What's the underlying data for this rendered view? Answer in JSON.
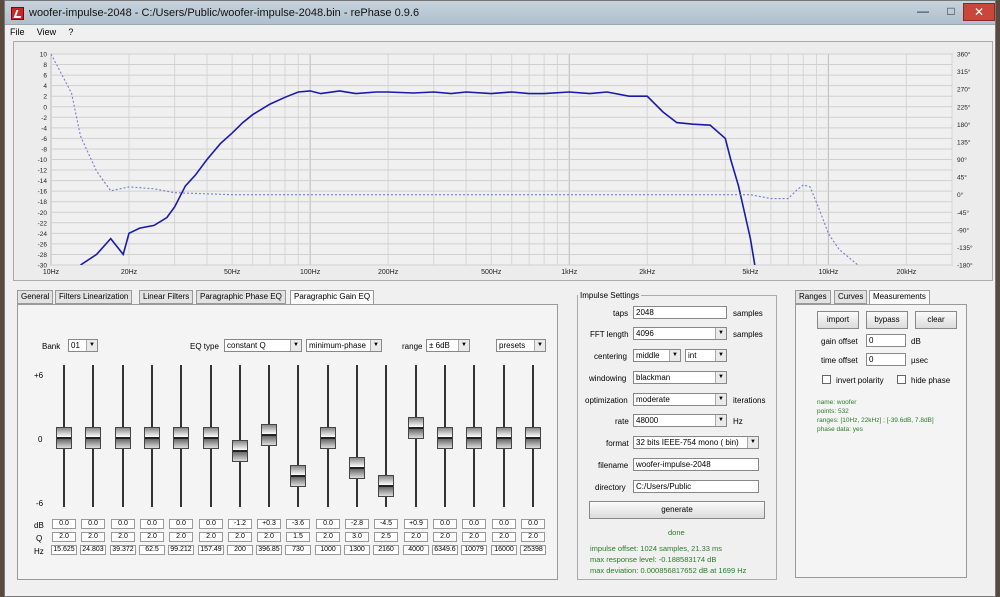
{
  "window": {
    "title": "woofer-impulse-2048  -  C:/Users/Public/woofer-impulse-2048.bin  -  rePhase 0.9.6"
  },
  "menu": [
    "File",
    "View",
    "?"
  ],
  "plot": {
    "y_left_ticks": [
      "10",
      "8",
      "6",
      "4",
      "2",
      "0",
      "-2",
      "-4",
      "-6",
      "-8",
      "-10",
      "-12",
      "-14",
      "-16",
      "-18",
      "-20",
      "-22",
      "-24",
      "-26",
      "-28",
      "-30"
    ],
    "y_right_ticks": [
      "360°",
      "315°",
      "270°",
      "225°",
      "180°",
      "135°",
      "90°",
      "45°",
      "0°",
      "-45°",
      "-90°",
      "-135°",
      "-180°"
    ],
    "x_ticks": [
      "10Hz",
      "20Hz",
      "50Hz",
      "100Hz",
      "200Hz",
      "500Hz",
      "1kHz",
      "2kHz",
      "5kHz",
      "10kHz",
      "20kHz"
    ]
  },
  "tabs": [
    "General",
    "Filters Linearization",
    "Linear Filters",
    "Paragraphic Phase EQ",
    "Paragraphic Gain EQ"
  ],
  "eq": {
    "bank_label": "Bank",
    "bank": "01",
    "eqtype_label": "EQ type",
    "eqtype": "constant Q",
    "phase": "minimum-phase",
    "range_label": "range",
    "range": "± 6dB",
    "presets": "presets",
    "scale": [
      "+6",
      "0",
      "-6"
    ],
    "row_labels": [
      "dB",
      "Q",
      "Hz"
    ],
    "db": [
      "0.0",
      "0.0",
      "0.0",
      "0.0",
      "0.0",
      "0.0",
      "-1.2",
      "+0.3",
      "-3.6",
      "0.0",
      "-2.8",
      "-4.5",
      "+0.9",
      "0.0",
      "0.0",
      "0.0",
      "0.0"
    ],
    "q": [
      "2.0",
      "2.0",
      "2.0",
      "2.0",
      "2.0",
      "2.0",
      "2.0",
      "2.0",
      "1.5",
      "2.0",
      "3.0",
      "2.5",
      "2.0",
      "2.0",
      "2.0",
      "2.0",
      "2.0"
    ],
    "hz": [
      "15.625",
      "24.803",
      "39.372",
      "62.5",
      "99.212",
      "157.49",
      "200",
      "396.85",
      "730",
      "1000",
      "1300",
      "2160",
      "4000",
      "6349.6",
      "10079",
      "16000",
      "25398"
    ]
  },
  "impulse": {
    "legend": "Impulse Settings",
    "taps_label": "taps",
    "taps": "2048",
    "taps_unit": "samples",
    "fft_label": "FFT length",
    "fft": "4096",
    "fft_unit": "samples",
    "centering_label": "centering",
    "centering": "middle",
    "centering2": "int",
    "windowing_label": "windowing",
    "windowing": "blackman",
    "optimization_label": "optimization",
    "optimization": "moderate",
    "optimization_unit": "iterations",
    "rate_label": "rate",
    "rate": "48000",
    "rate_unit": "Hz",
    "format_label": "format",
    "format": "32 bits IEEE-754 mono ( bin)",
    "filename_label": "filename",
    "filename": "woofer-impulse-2048",
    "directory_label": "directory",
    "directory": "C:/Users/Public",
    "generate": "generate",
    "status": "done",
    "result1": "impulse offset: 1024 samples, 21.33 ms",
    "result2": "max response level: -0.188583174 dB",
    "result3": "max deviation: 0.000856817652 dB at 1699 Hz"
  },
  "right_tabs": [
    "Ranges",
    "Curves",
    "Measurements"
  ],
  "measure": {
    "import": "import",
    "bypass": "bypass",
    "clear": "clear",
    "gain_label": "gain offset",
    "gain": "0",
    "gain_unit": "dB",
    "time_label": "time offset",
    "time": "0",
    "time_unit": "µsec",
    "invert": "invert polarity",
    "hide": "hide phase",
    "info1": "name: woofer",
    "info2": "points: 532",
    "info3": "ranges: [10Hz, 22kHz] ; [-39.6dB, 7.8dB]",
    "info4": "phase data: yes"
  },
  "colors": {
    "magnitude": "#1a1aa8",
    "phase": "#7a7ac8"
  },
  "chart_data": {
    "type": "line",
    "x_scale": "log",
    "xlim": [
      10,
      30000
    ],
    "ylim": [
      -30,
      10
    ],
    "y2lim": [
      -180,
      360
    ],
    "series": [
      {
        "axis": "left",
        "style": "solid",
        "x": [
          13,
          15,
          17,
          19,
          20,
          22,
          25,
          28,
          30,
          33,
          36,
          40,
          45,
          50,
          55,
          60,
          70,
          80,
          90,
          100,
          110,
          130,
          150,
          180,
          200,
          250,
          300,
          350,
          400,
          500,
          600,
          700,
          800,
          1000,
          1200,
          1400,
          1700,
          2000,
          2300,
          2600,
          3000,
          3500,
          4000,
          4200,
          4500,
          5000,
          5200
        ],
        "y": [
          -30,
          -28,
          -25,
          -28,
          -24,
          -23,
          -22.5,
          -21,
          -19,
          -15,
          -13,
          -10,
          -7,
          -5,
          -3,
          -1.5,
          0.5,
          1.8,
          2.8,
          3,
          2.5,
          3,
          2.5,
          2.8,
          2.8,
          2.6,
          2.8,
          2.5,
          2.8,
          2.5,
          2.8,
          2.5,
          2.5,
          2.8,
          2.5,
          2.8,
          2,
          2,
          -1,
          -3,
          -3.3,
          -3.5,
          -6,
          -10,
          -15,
          -25,
          -30
        ]
      },
      {
        "axis": "right",
        "style": "dotted",
        "x": [
          10,
          12,
          13,
          15,
          17,
          20,
          25,
          30,
          50,
          100,
          500,
          1000,
          3000,
          5000,
          6000,
          7000,
          7500,
          8000,
          8500,
          9000,
          9500,
          10000,
          11000,
          13000
        ],
        "y": [
          360,
          260,
          150,
          60,
          10,
          20,
          15,
          5,
          0,
          0,
          0,
          0,
          0,
          0,
          -10,
          -10,
          10,
          25,
          20,
          -20,
          -60,
          -100,
          -140,
          -180
        ]
      }
    ]
  }
}
